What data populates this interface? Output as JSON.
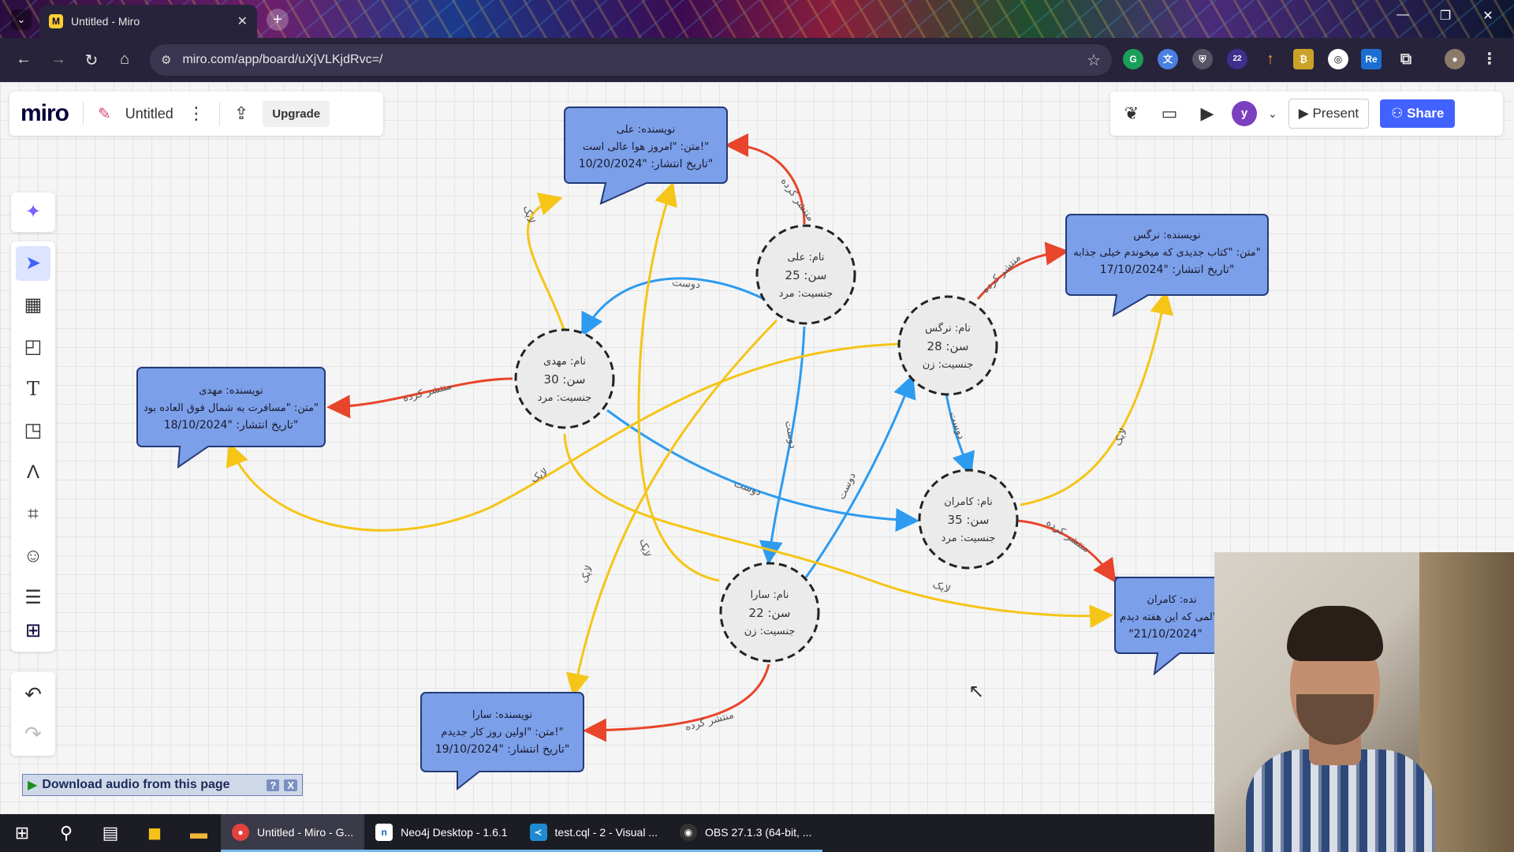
{
  "browser": {
    "tab_title": "Untitled - Miro",
    "tab_favicon": "miro-icon",
    "url": "miro.com/app/board/uXjVLKjdRvc=/",
    "extension_badge": "22"
  },
  "miro": {
    "logo": "miro",
    "board_title": "Untitled",
    "upgrade_label": "Upgrade",
    "present_label": "Present",
    "share_label": "Share",
    "avatar_letter": "y",
    "accent_color": "#4262ff"
  },
  "graph": {
    "person_nodes": [
      {
        "id": "ali",
        "name": "نام: علی",
        "age": "سن: 25",
        "gender": "جنسیت: مرد"
      },
      {
        "id": "mahdi",
        "name": "نام: مهدی",
        "age": "سن: 30",
        "gender": "جنسیت: مرد"
      },
      {
        "id": "narges",
        "name": "نام: نرگس",
        "age": "سن: 28",
        "gender": "جنسیت: زن"
      },
      {
        "id": "kamran",
        "name": "نام: کامران",
        "age": "سن: 35",
        "gender": "جنسیت: مرد"
      },
      {
        "id": "sara",
        "name": "نام: سارا",
        "age": "سن: 22",
        "gender": "جنسیت: زن"
      }
    ],
    "post_nodes": [
      {
        "id": "post-ali",
        "author": "نویسنده: علی",
        "text": "متن: \"امروز هوا عالی است!\"",
        "date": "تاریخ انتشار: \"10/20/2024\""
      },
      {
        "id": "post-narges",
        "author": "نویسنده: نرگس",
        "text": "متن: \"کتاب جدیدی که میخوندم خیلی جذابه\"",
        "date": "تاریخ انتشار: \"17/10/2024\""
      },
      {
        "id": "post-mahdi",
        "author": "نویسنده: مهدی",
        "text": "متن: \"مسافرت به شمال فوق العاده بود\"",
        "date": "تاریخ انتشار: \"18/10/2024\""
      },
      {
        "id": "post-sara",
        "author": "نویسنده: سارا",
        "text": "متن: \"اولین روز کار جدیدم!\"",
        "date": "تاریخ انتشار: \"19/10/2024\""
      },
      {
        "id": "post-kamran",
        "author": "نده: کامران",
        "text": "لمی که این هفته دیدم\"",
        "date": "\"21/10/2024\""
      }
    ],
    "edge_labels": {
      "published": "منتشر کرده",
      "friend": "دوست",
      "like": "لایک"
    },
    "colors": {
      "published": "#e8452c",
      "friend": "#2d9bf0",
      "like": "#f5c518",
      "post_fill": "#7b9fe8"
    }
  },
  "download_bar": {
    "label": "Download audio from this page",
    "help": "?",
    "close": "X"
  },
  "taskbar": {
    "apps": [
      {
        "label": "Untitled - Miro - G..."
      },
      {
        "label": "Neo4j Desktop - 1.6.1"
      },
      {
        "label": "test.cql - 2 - Visual ..."
      },
      {
        "label": "OBS 27.1.3 (64-bit, ..."
      }
    ]
  }
}
